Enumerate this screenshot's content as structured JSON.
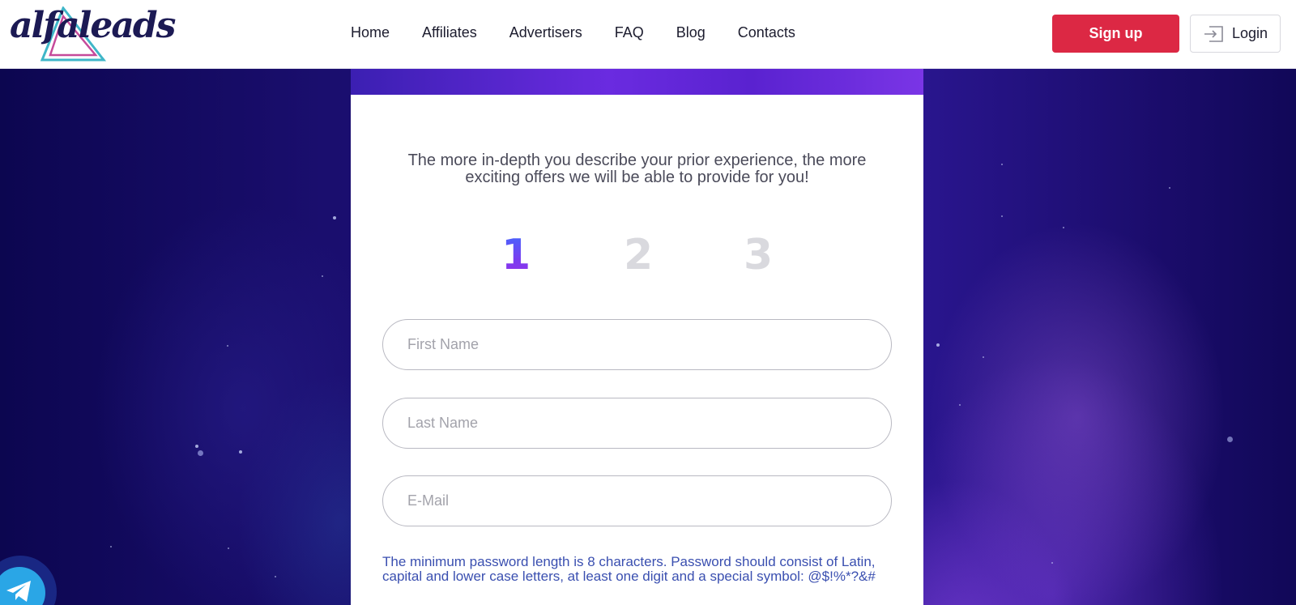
{
  "header": {
    "logo_text": "alfaleads",
    "nav": [
      {
        "label": "Home"
      },
      {
        "label": "Affiliates"
      },
      {
        "label": "Advertisers"
      },
      {
        "label": "FAQ"
      },
      {
        "label": "Blog"
      },
      {
        "label": "Contacts"
      }
    ],
    "signup_label": "Sign up",
    "login_label": "Login",
    "login_icon": "login-icon"
  },
  "form": {
    "intro": "The more in-depth you describe your prior experience, the more exciting offers we will be able to provide for you!",
    "steps": [
      {
        "label": "1",
        "state": "active"
      },
      {
        "label": "2",
        "state": "inactive"
      },
      {
        "label": "3",
        "state": "inactive"
      }
    ],
    "fields": {
      "first_name": {
        "placeholder": "First Name",
        "value": ""
      },
      "last_name": {
        "placeholder": "Last Name",
        "value": ""
      },
      "email": {
        "placeholder": "E-Mail",
        "value": ""
      }
    },
    "password_hint": "The minimum password length is 8 characters. Password should consist of Latin, capital and lower case letters, at least one digit and a special symbol: @$!%*?&#"
  },
  "floating": {
    "telegram_icon": "telegram-icon"
  },
  "colors": {
    "brand_navy": "#1c1a54",
    "signup_red": "#dc2844",
    "step_active_start": "#3f6bff",
    "step_active_end": "#9a2fe8",
    "step_inactive": "#d9d9de",
    "hint_blue": "#3a4fb0",
    "telegram_blue": "#2aa6e6"
  }
}
